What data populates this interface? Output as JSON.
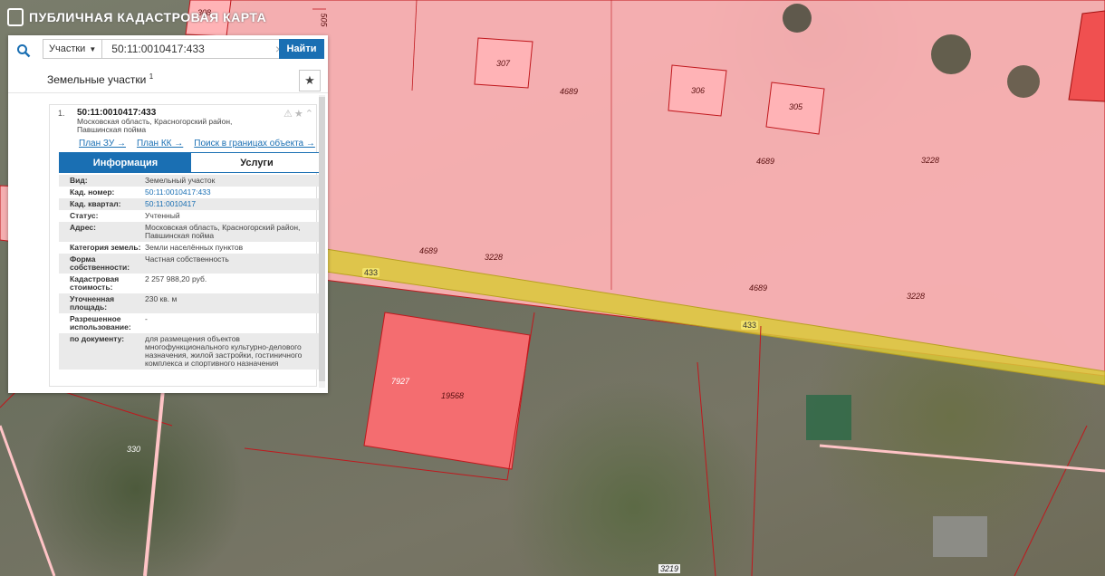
{
  "app": {
    "title": "ПУБЛИЧНАЯ КАДАСТРОВАЯ КАРТА"
  },
  "search": {
    "type_label": "Участки",
    "query": "50:11:0010417:433",
    "clear_glyph": "×",
    "find_label": "Найти"
  },
  "results": {
    "title": "Земельные участки",
    "count": "1"
  },
  "item": {
    "number": "1.",
    "cad_number": "50:11:0010417:433",
    "address": "Московская область, Красногорский район, Павшинская пойма",
    "links": {
      "plan_zu": "План ЗУ →",
      "plan_kk": "План КК →",
      "search_bounds": "Поиск в границах объекта →"
    },
    "tabs": {
      "info": "Информация",
      "services": "Услуги"
    },
    "attributes": [
      {
        "k": "Вид:",
        "v": "Земельный участок"
      },
      {
        "k": "Кад. номер:",
        "v": "50:11:0010417:433",
        "link": true
      },
      {
        "k": "Кад. квартал:",
        "v": "50:11:0010417",
        "link": true
      },
      {
        "k": "Статус:",
        "v": "Учтенный"
      },
      {
        "k": "Адрес:",
        "v": "Московская область, Красногорский район, Павшинская пойма"
      },
      {
        "k": "Категория земель:",
        "v": "Земли населённых пунктов"
      },
      {
        "k": "Форма собственности:",
        "v": "Частная собственность"
      },
      {
        "k": "Кадастровая стоимость:",
        "v": "2 257 988,20 руб."
      },
      {
        "k": "Уточненная площадь:",
        "v": "230 кв. м"
      },
      {
        "k": "Разрешенное использование:",
        "v": "-"
      },
      {
        "k": "по документу:",
        "v": "для размещения объектов многофункционального культурно-делового назначения, жилой застройки, гостиничного комплекса и спортивного назначения"
      }
    ]
  },
  "map_labels": {
    "l308": "308",
    "l505": "505",
    "l307": "307",
    "l306": "306",
    "l305": "305",
    "l4689a": "4689",
    "l4689b": "4689",
    "l4689c": "4689",
    "l4689d": "4689",
    "l3228a": "3228",
    "l3228b": "3228",
    "l3228c": "3228",
    "l433a": "433",
    "l433b": "433",
    "l7927": "7927",
    "l19568": "19568",
    "l330": "330",
    "l3219": "3219"
  },
  "colors": {
    "accent": "#1a6fb3",
    "parcel_fill": "#ffb3b6",
    "parcel_selected": "#f07a7c",
    "highlight": "#e8d23a"
  }
}
